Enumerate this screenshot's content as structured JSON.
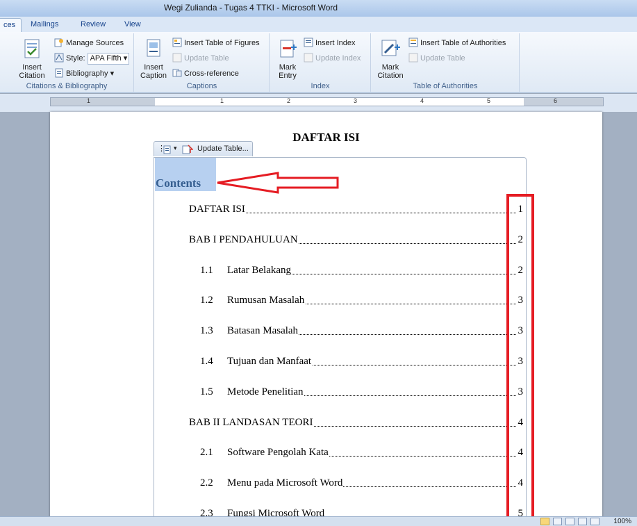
{
  "window": {
    "title": "Wegi Zulianda - Tugas 4 TTKI  -  Microsoft Word"
  },
  "tabs": [
    {
      "label": "ces",
      "active": true
    },
    {
      "label": "Mailings"
    },
    {
      "label": "Review"
    },
    {
      "label": "View"
    }
  ],
  "ribbon": {
    "citations": {
      "group_label": "Citations & Bibliography",
      "insert_citation": "Insert Citation",
      "manage_sources": "Manage Sources",
      "style_label": "Style:",
      "style_value": "APA Fifth",
      "bibliography": "Bibliography"
    },
    "captions": {
      "group_label": "Captions",
      "insert_caption": "Insert Caption",
      "insert_table_of_figures": "Insert Table of Figures",
      "update_table": "Update Table",
      "cross_reference": "Cross-reference"
    },
    "index": {
      "group_label": "Index",
      "mark_entry": "Mark Entry",
      "insert_index": "Insert Index",
      "update_index": "Update Index"
    },
    "authorities": {
      "group_label": "Table of Authorities",
      "mark_citation": "Mark Citation",
      "insert_table_of_authorities": "Insert Table of Authorities",
      "update_table": "Update Table"
    }
  },
  "ruler": {
    "numbers": [
      "1",
      "1",
      "2",
      "3",
      "4",
      "5",
      "6"
    ]
  },
  "document": {
    "title": "DAFTAR ISI",
    "toc_handle_label": "Update Table...",
    "toc_heading": "Contents",
    "toc": [
      {
        "num": "",
        "text": "DAFTAR ISI",
        "page": "1",
        "level": 1
      },
      {
        "num": "",
        "text": "BAB I PENDAHULUAN",
        "page": "2",
        "level": 1
      },
      {
        "num": "1.1",
        "text": "Latar Belakang",
        "page": "2",
        "level": 2
      },
      {
        "num": "1.2",
        "text": "Rumusan Masalah",
        "page": "3",
        "level": 2
      },
      {
        "num": "1.3",
        "text": "Batasan Masalah",
        "page": "3",
        "level": 2
      },
      {
        "num": "1.4",
        "text": "Tujuan dan Manfaat",
        "page": "3",
        "level": 2
      },
      {
        "num": "1.5",
        "text": "Metode Penelitian",
        "page": "3",
        "level": 2
      },
      {
        "num": "",
        "text": "BAB II LANDASAN TEORI",
        "page": "4",
        "level": 1
      },
      {
        "num": "2.1",
        "text": "Software Pengolah Kata",
        "page": "4",
        "level": 2
      },
      {
        "num": "2.2",
        "text": "Menu pada Microsoft Word",
        "page": "4",
        "level": 2
      },
      {
        "num": "2.3",
        "text": "Fungsi Microsoft Word",
        "page": "5",
        "level": 2
      }
    ]
  },
  "statusbar": {
    "zoom": "100%"
  },
  "colors": {
    "annotation_red": "#e51c23",
    "heading_blue": "#365f91",
    "selection": "#b7d0f0"
  }
}
